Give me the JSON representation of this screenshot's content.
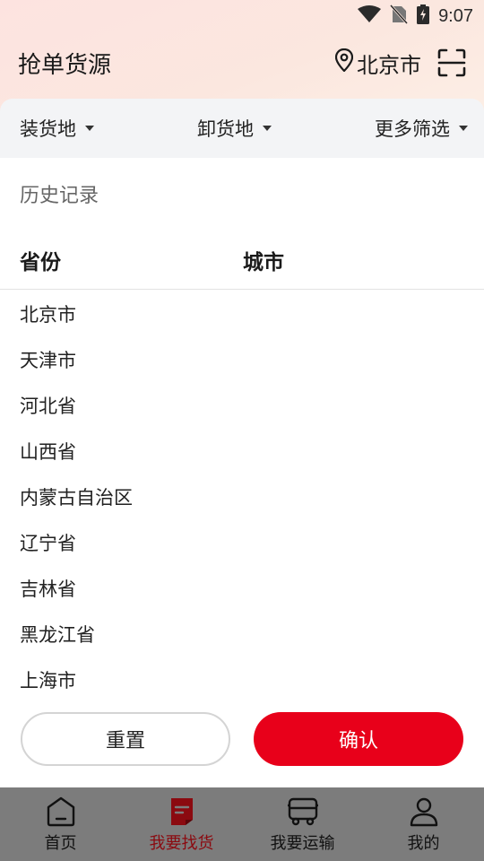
{
  "status_bar": {
    "time": "9:07"
  },
  "header": {
    "title": "抢单货源",
    "location": "北京市"
  },
  "filters": [
    {
      "label": "装货地"
    },
    {
      "label": "卸货地"
    },
    {
      "label": "更多筛选"
    }
  ],
  "panel": {
    "history_title": "历史记录",
    "col_province": "省份",
    "col_city": "城市",
    "provinces": [
      "北京市",
      "天津市",
      "河北省",
      "山西省",
      "内蒙古自治区",
      "辽宁省",
      "吉林省",
      "黑龙江省",
      "上海市"
    ],
    "reset_label": "重置",
    "confirm_label": "确认"
  },
  "tabs": [
    {
      "label": "首页",
      "icon": "home-icon"
    },
    {
      "label": "我要找货",
      "icon": "document-icon",
      "active": true
    },
    {
      "label": "我要运输",
      "icon": "truck-icon"
    },
    {
      "label": "我的",
      "icon": "user-icon"
    }
  ],
  "colors": {
    "accent": "#e8001a",
    "active_tab": "#8b0a10"
  }
}
